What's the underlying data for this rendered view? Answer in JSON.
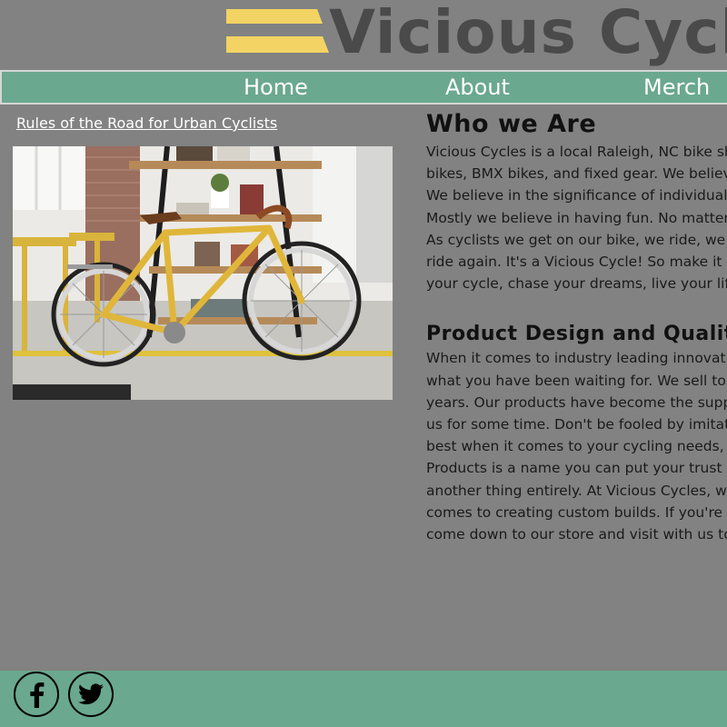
{
  "header": {
    "brand_name": "Vicious Cycles",
    "brand_color": "#4a4a4a",
    "logo_stripe_color": "#f2d363"
  },
  "nav": {
    "background": "#6aa88f",
    "items": [
      {
        "label": "Home"
      },
      {
        "label": "About"
      },
      {
        "label": "Merch"
      }
    ]
  },
  "sidebar": {
    "article_link": "Rules of the Road for Urban Cyclists",
    "photo": {
      "subject": "yellow-fixed-gear-bicycle-icon"
    }
  },
  "main": {
    "sections": [
      {
        "heading": "Who we Are",
        "lines": [
          "Vicious Cycles is a local Raleigh, NC bike sh",
          "bikes, BMX bikes, and fixed gear. We believe",
          "We believe in the significance of individualis",
          "Mostly we believe in having fun. No matter",
          "As cyclists we get on our bike, we ride, we f",
          "ride again. It's a Vicious Cycle! So make it w",
          "your cycle, chase your dreams, live your life."
        ]
      },
      {
        "heading": "Product Design and Quality",
        "lines": [
          "When it comes to industry leading innovatio",
          "what you have been waiting for. We sell top",
          "years. Our products have become the suppl",
          "us for some time. Don't be fooled by imitato",
          "best when it comes to your cycling needs, b",
          "Products is a name you can put your trust in",
          "another thing entirely. At Vicious Cycles, we",
          "comes to creating custom builds. If you're in",
          "come down to our store and visit with us to"
        ]
      }
    ]
  },
  "footer": {
    "background": "#6aa88f",
    "social": [
      {
        "icon": "facebook-icon"
      },
      {
        "icon": "twitter-icon"
      }
    ]
  }
}
